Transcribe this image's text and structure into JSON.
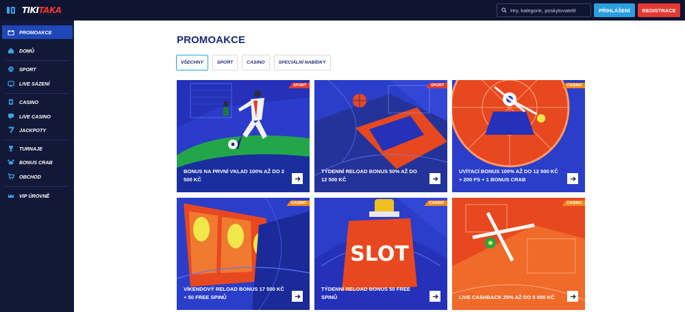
{
  "header": {
    "logo_part1": "TIKI",
    "logo_part2": "TAKA",
    "search_placeholder": "Hry, kategorie, poskytovatelé",
    "login_label": "PŘIHLÁŠENÍ",
    "register_label": "REGISTRACE"
  },
  "sidebar": {
    "items": [
      {
        "label": "PROMOAKCE",
        "icon": "gift-icon"
      },
      {
        "label": "DOMŮ",
        "icon": "home-icon"
      },
      {
        "label": "SPORT",
        "icon": "ball-icon"
      },
      {
        "label": "LIVE SÁZENÍ",
        "icon": "tv-icon"
      },
      {
        "label": "CASINO",
        "icon": "cards-icon"
      },
      {
        "label": "LIVE CASINO",
        "icon": "chat-icon"
      },
      {
        "label": "JACKPOTY",
        "icon": "seven-icon"
      },
      {
        "label": "TURNAJE",
        "icon": "trophy-icon"
      },
      {
        "label": "BONUS CRAB",
        "icon": "crab-icon"
      },
      {
        "label": "OBCHOD",
        "icon": "cart-icon"
      },
      {
        "label": "VIP ÚROVNĚ",
        "icon": "crown-icon"
      }
    ]
  },
  "main": {
    "title": "PROMOAKCE",
    "tabs": [
      "VŠECHNY",
      "SPORT",
      "CASINO",
      "SPECIÁLNÍ NABÍDKY"
    ],
    "cards": [
      {
        "badge": "SPORT",
        "title": "BONUS NA PRVNÍ VKLAD 100% AŽ DO 2 500 KČ"
      },
      {
        "badge": "SPORT",
        "title": "TÝDENNÍ RELOAD BONUS 50% AŽ DO 12 500 KČ"
      },
      {
        "badge": "CASINO",
        "title": "UVÍTACÍ BONUS 100% AŽ DO 12 500 KČ + 200 FS + 1 BONUS CRAB"
      },
      {
        "badge": "CASINO",
        "title": "VÍKENDOVÝ RELOAD BONUS 17 500 KČ + 50 FREE SPINŮ"
      },
      {
        "badge": "CASINO",
        "title": "TÝDENNÍ RELOAD BONUS 50 FREE SPINŮ",
        "art_text": "SLOT"
      },
      {
        "badge": "CASINO",
        "title": "LIVE CASHBACK 25% AŽ DO 5 000 KČ"
      }
    ]
  },
  "colors": {
    "topbar": "#0f1430",
    "sidebar": "#121838",
    "active": "#1f47b8",
    "login": "#2a9fe0",
    "register": "#e23a31",
    "title": "#1b2a7a"
  }
}
